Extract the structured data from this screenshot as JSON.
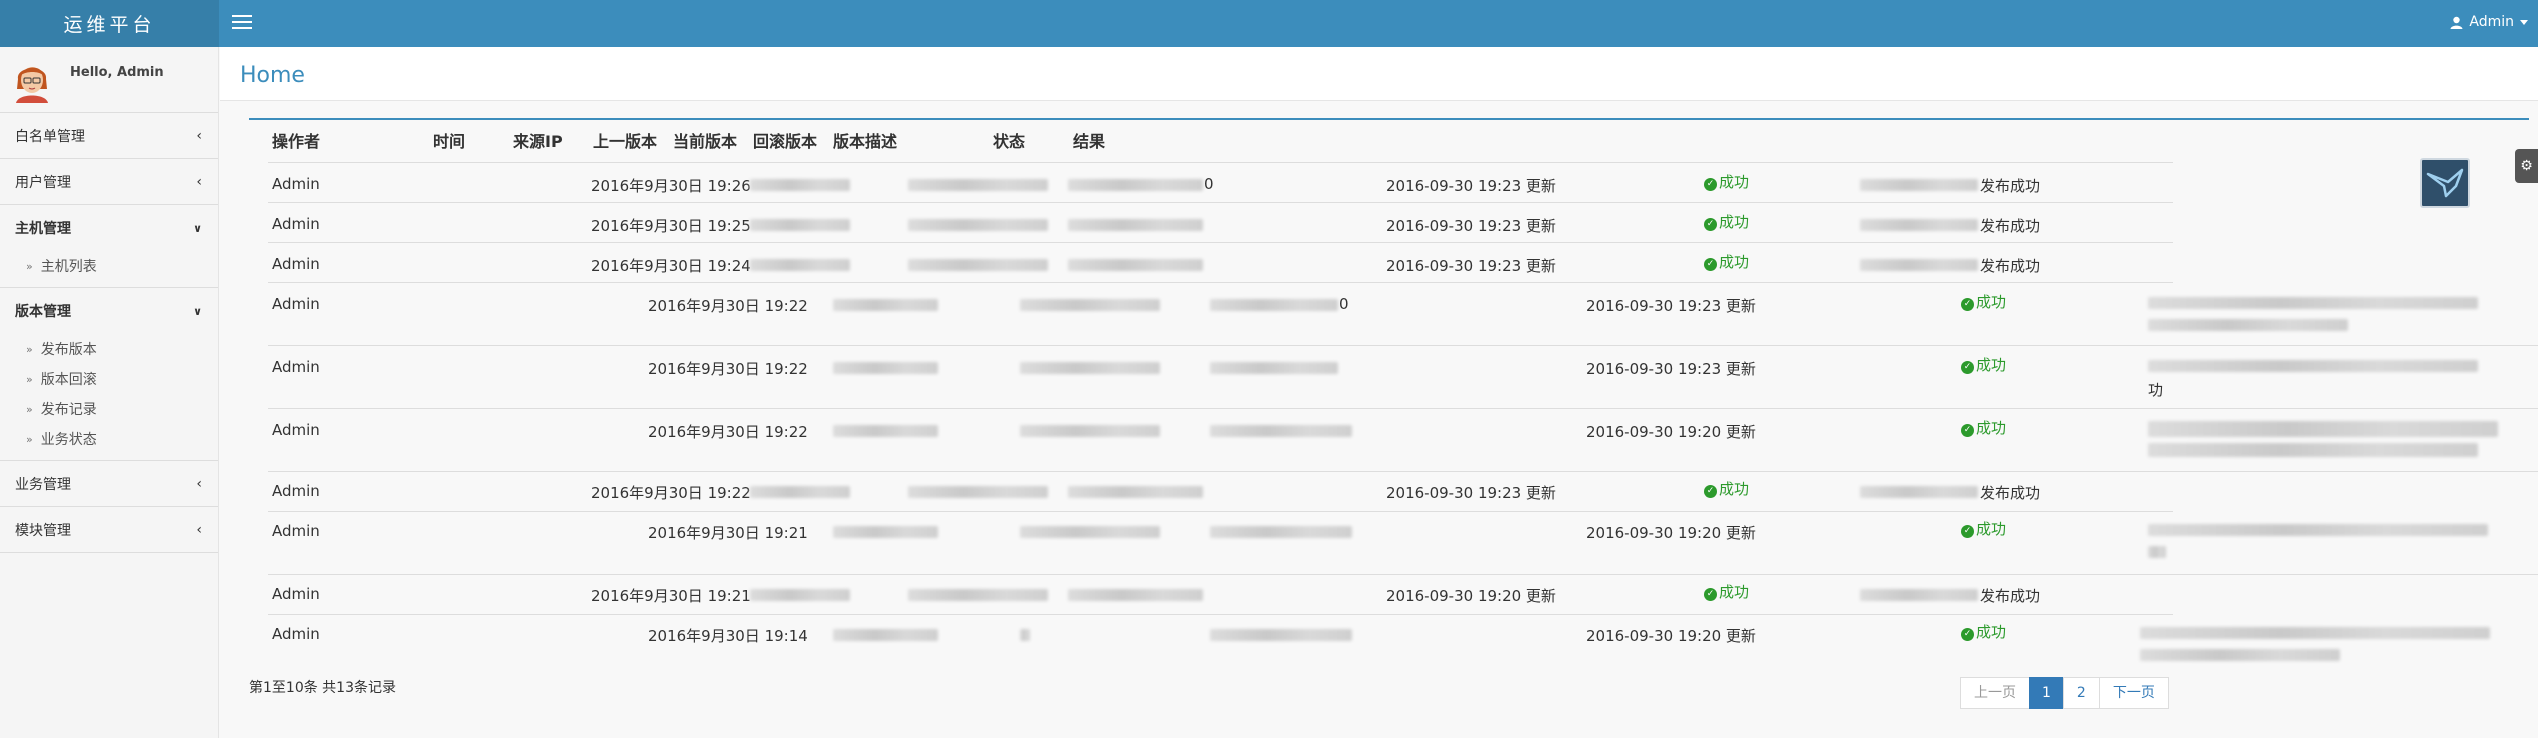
{
  "app": {
    "title": "运维平台"
  },
  "topbar": {
    "user_label": "Admin"
  },
  "sidebar": {
    "greeting": "Hello, Admin",
    "menus": [
      {
        "label": "白名单管理"
      },
      {
        "label": "用户管理"
      },
      {
        "label": "主机管理",
        "children": [
          "主机列表"
        ]
      },
      {
        "label": "版本管理",
        "children": [
          "发布版本",
          "版本回滚",
          "发布记录",
          "业务状态"
        ]
      },
      {
        "label": "业务管理"
      },
      {
        "label": "模块管理"
      }
    ]
  },
  "page": {
    "title": "Home"
  },
  "table": {
    "headers": [
      "操作者",
      "时间",
      "来源IP",
      "上一版本",
      "当前版本",
      "回滚版本",
      "版本描述",
      "状态",
      "结果"
    ],
    "rows": [
      {
        "operator": "Admin",
        "time": "2016年9月30日 19:26",
        "desc": "2016-09-30 19:23 更新",
        "status": "成功",
        "result": "发布成功",
        "tail": "0"
      },
      {
        "operator": "Admin",
        "time": "2016年9月30日 19:25",
        "desc": "2016-09-30 19:23 更新",
        "status": "成功",
        "result": "发布成功",
        "tail": ""
      },
      {
        "operator": "Admin",
        "time": "2016年9月30日 19:24",
        "desc": "2016-09-30 19:23 更新",
        "status": "成功",
        "result": "发布成功",
        "tail": ""
      },
      {
        "operator": "Admin",
        "time": "2016年9月30日 19:22",
        "desc": "2016-09-30 19:23 更新",
        "status": "成功",
        "result": "",
        "tail": "0"
      },
      {
        "operator": "Admin",
        "time": "2016年9月30日 19:22",
        "desc": "2016-09-30 19:23 更新",
        "status": "成功",
        "result": "功",
        "tail": ""
      },
      {
        "operator": "Admin",
        "time": "2016年9月30日 19:22",
        "desc": "2016-09-30 19:20 更新",
        "status": "成功",
        "result": "",
        "tail": ""
      },
      {
        "operator": "Admin",
        "time": "2016年9月30日 19:22",
        "desc": "2016-09-30 19:23 更新",
        "status": "成功",
        "result": "发布成功",
        "tail": ""
      },
      {
        "operator": "Admin",
        "time": "2016年9月30日 19:21",
        "desc": "2016-09-30 19:20 更新",
        "status": "成功",
        "result": "",
        "tail": ""
      },
      {
        "operator": "Admin",
        "time": "2016年9月30日 19:21",
        "desc": "2016-09-30 19:20 更新",
        "status": "成功",
        "result": "发布成功",
        "tail": ""
      },
      {
        "operator": "Admin",
        "time": "2016年9月30日 19:14",
        "desc": "2016-09-30 19:20 更新",
        "status": "成功",
        "result": "",
        "tail": ""
      }
    ]
  },
  "footer": {
    "summary": "第1至10条 共13条记录",
    "pagination": {
      "prev": "上一页",
      "pages": [
        "1",
        "2"
      ],
      "current": "1",
      "next": "下一页"
    }
  }
}
